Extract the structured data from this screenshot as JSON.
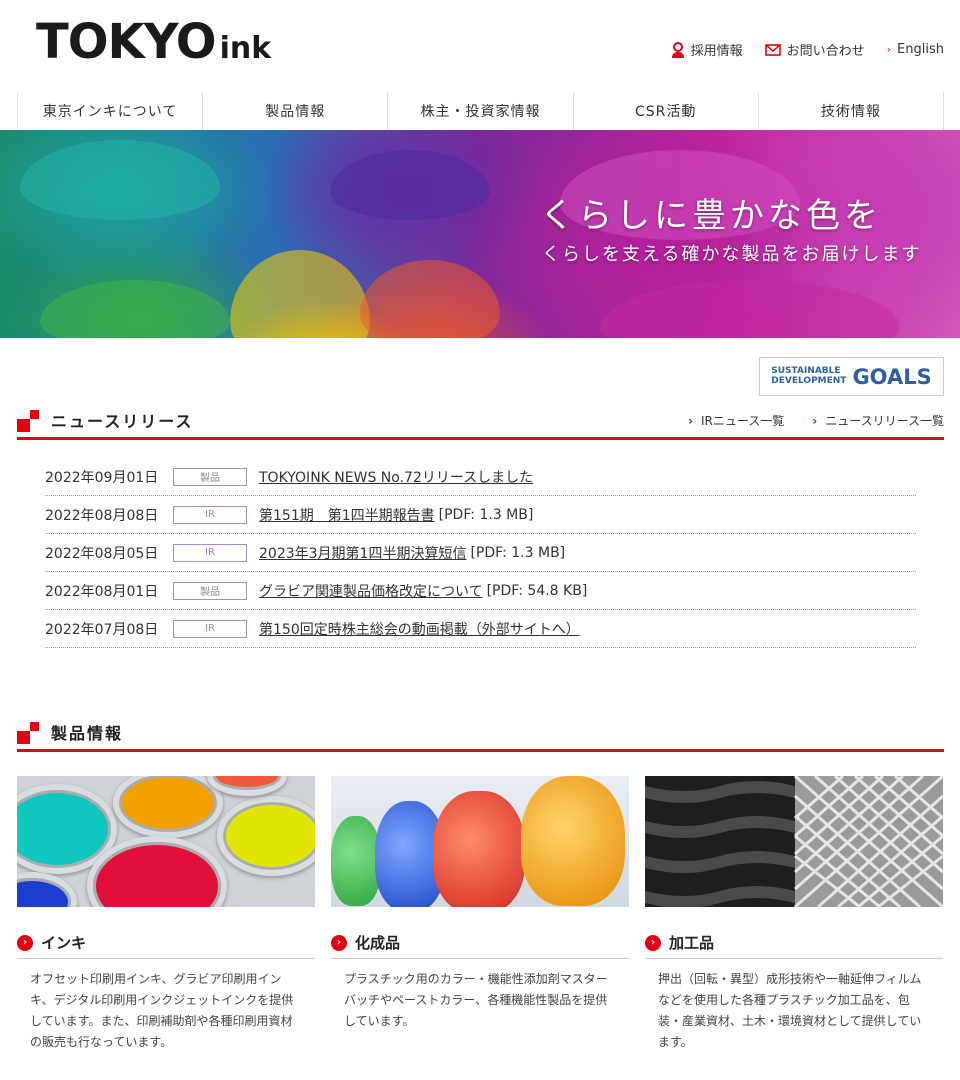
{
  "header": {
    "logo_main": "TOKYO",
    "logo_sub": "ink",
    "util": [
      {
        "label": "採用情報",
        "icon": "person-icon"
      },
      {
        "label": "お問い合わせ",
        "icon": "mail-icon"
      },
      {
        "label": "English",
        "icon": "chevron-right-icon"
      }
    ]
  },
  "nav": [
    "東京インキについて",
    "製品情報",
    "株主・投資家情報",
    "CSR活動",
    "技術情報"
  ],
  "hero": {
    "title": "くらしに豊かな色を",
    "subtitle": "くらしを支える確かな製品をお届けします"
  },
  "sdg": {
    "line1": "SUSTAINABLE",
    "line2": "DEVELOPMENT",
    "goals": "GOALS"
  },
  "news": {
    "title": "ニュースリリース",
    "links": [
      "IRニュース一覧",
      "ニュースリリース一覧"
    ],
    "items": [
      {
        "date": "2022年09月01日",
        "tag": "製品",
        "type": "product",
        "text": "TOKYOINK NEWS No.72リリースしました",
        "meta": ""
      },
      {
        "date": "2022年08月08日",
        "tag": "IR",
        "type": "ir",
        "text": "第151期　第1四半期報告書",
        "meta": "[PDF: 1.3 MB]"
      },
      {
        "date": "2022年08月05日",
        "tag": "IR",
        "type": "ir",
        "text": "2023年3月期第1四半期決算短信",
        "meta": "[PDF: 1.3 MB]"
      },
      {
        "date": "2022年08月01日",
        "tag": "製品",
        "type": "product",
        "text": "グラビア関連製品価格改定について",
        "meta": "[PDF: 54.8 KB]"
      },
      {
        "date": "2022年07月08日",
        "tag": "IR",
        "type": "ir",
        "text": "第150回定時株主総会の動画掲載（外部サイトへ）",
        "meta": ""
      }
    ]
  },
  "products": {
    "title": "製品情報",
    "items": [
      {
        "name": "インキ",
        "desc": "オフセット印刷用インキ、グラビア印刷用インキ、デジタル印刷用インクジェットインクを提供しています。また、印刷補助剤や各種印刷用資材の販売も行なっています。"
      },
      {
        "name": "化成品",
        "desc": "プラスチック用のカラー・機能性添加剤マスターバッチやペーストカラー、各種機能性製品を提供しています。"
      },
      {
        "name": "加工品",
        "desc": "押出（回転・異型）成形技術や一軸延伸フィルムなどを使用した各種プラスチック加工品を、包装・産業資材、土木・環境資材として提供しています。"
      }
    ]
  },
  "colors": {
    "accent": "#e60012",
    "ir_tag": "#a48ad0",
    "sdg_blue": "#2f5f9e"
  }
}
